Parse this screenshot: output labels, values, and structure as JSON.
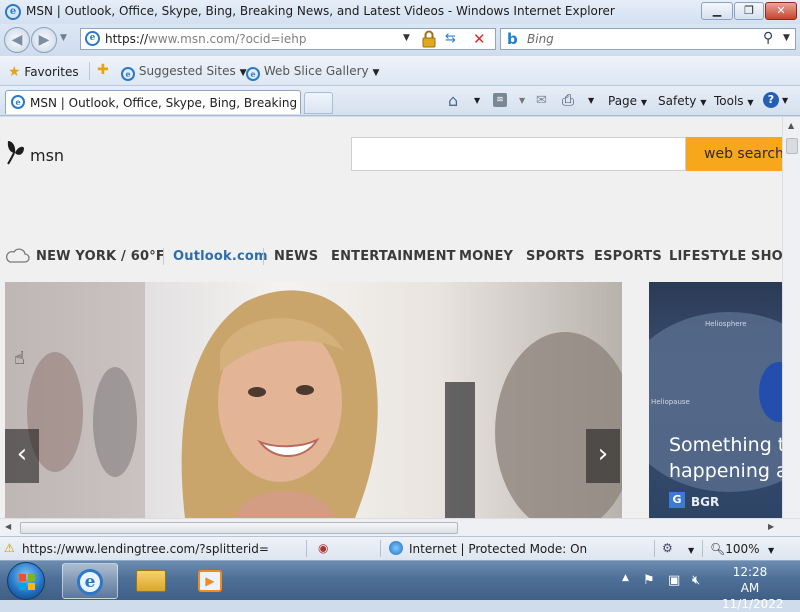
{
  "window": {
    "title": "MSN | Outlook, Office, Skype, Bing, Breaking News, and Latest Videos - Windows Internet Explorer",
    "minimize": "▁",
    "restore": "❐",
    "close": "✕"
  },
  "address_bar": {
    "url_host": "https://",
    "url_rest": "www.msn.com/?ocid=iehp",
    "search_placeholder": "Bing"
  },
  "favorites_bar": {
    "favorites_label": "Favorites",
    "items": [
      "Suggested Sites",
      "Web Slice Gallery"
    ]
  },
  "tabs": {
    "active_title": "MSN | Outlook, Office, Skype, Bing, Breaking Ne..."
  },
  "command_bar": {
    "page": "Page",
    "safety": "Safety",
    "tools": "Tools"
  },
  "msn": {
    "logo_text": "msn",
    "search_button": "web search",
    "weather": "NEW YORK / 60°F",
    "nav": [
      "Outlook.com",
      "NEWS",
      "ENTERTAINMENT",
      "MONEY",
      "SPORTS",
      "ESPORTS",
      "LIFESTYLE",
      "SHO"
    ],
    "side_card": {
      "title_line1": "Something to",
      "title_line2": "happening at",
      "source": "BGR",
      "image_label_1": "Heliosphere",
      "image_label_2": "Heliopause"
    }
  },
  "status_bar": {
    "link_url": "https://www.lendingtree.com/?splitterid=",
    "zone": "Internet | Protected Mode: On",
    "zoom": "100%"
  },
  "taskbar": {
    "time": "12:28 AM",
    "date": "11/1/2022"
  },
  "colors": {
    "accent_search": "#f7a71b",
    "outlook_link": "#2d6ea8"
  }
}
